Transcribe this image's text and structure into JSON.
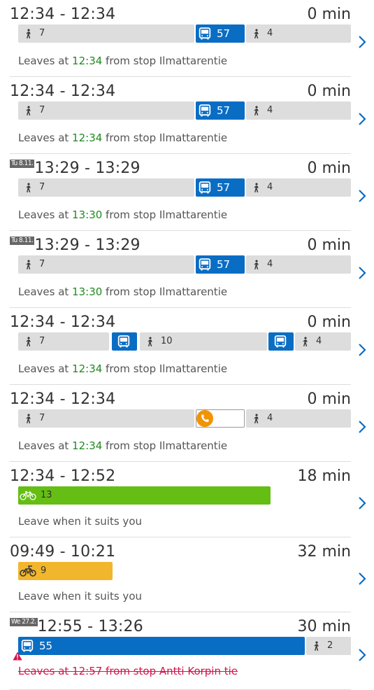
{
  "itineraries": [
    {
      "timeline": "12:34 - 12:34",
      "date_badge": "",
      "duration": "0 min",
      "legs": [
        {
          "mode": "walk",
          "label": "7"
        },
        {
          "mode": "bus",
          "label": "57"
        },
        {
          "mode": "walk",
          "label": "4"
        }
      ],
      "info_prefix": "Leaves at ",
      "info_time": "12:34",
      "info_suffix": " from stop Ilmattarentie",
      "cancelled": false
    },
    {
      "timeline": "12:34 - 12:34",
      "date_badge": "",
      "duration": "0 min",
      "legs": [
        {
          "mode": "walk",
          "label": "7"
        },
        {
          "mode": "bus",
          "label": "57"
        },
        {
          "mode": "walk",
          "label": "4"
        }
      ],
      "info_prefix": "Leaves at ",
      "info_time": "12:34",
      "info_suffix": " from stop Ilmattarentie",
      "cancelled": false
    },
    {
      "timeline": "13:29 - 13:29",
      "date_badge": "Tu 8.11.",
      "duration": "0 min",
      "legs": [
        {
          "mode": "walk",
          "label": "7"
        },
        {
          "mode": "bus",
          "label": "57"
        },
        {
          "mode": "walk",
          "label": "4"
        }
      ],
      "info_prefix": "Leaves at ",
      "info_time": "13:30",
      "info_suffix": " from stop Ilmattarentie",
      "cancelled": false
    },
    {
      "timeline": "13:29 - 13:29",
      "date_badge": "Tu 8.11.",
      "duration": "0 min",
      "legs": [
        {
          "mode": "walk",
          "label": "7"
        },
        {
          "mode": "bus",
          "label": "57"
        },
        {
          "mode": "walk",
          "label": "4"
        }
      ],
      "info_prefix": "Leaves at ",
      "info_time": "13:30",
      "info_suffix": " from stop Ilmattarentie",
      "cancelled": false
    },
    {
      "timeline": "12:34 - 12:34",
      "date_badge": "",
      "duration": "0 min",
      "legs": [
        {
          "mode": "walk",
          "label": "7"
        },
        {
          "mode": "bus-icon",
          "label": ""
        },
        {
          "mode": "walk",
          "label": "10"
        },
        {
          "mode": "bus-icon",
          "label": ""
        },
        {
          "mode": "walk",
          "label": "4"
        }
      ],
      "info_prefix": "Leaves at ",
      "info_time": "12:34",
      "info_suffix": " from stop Ilmattarentie",
      "cancelled": false
    },
    {
      "timeline": "12:34 - 12:34",
      "date_badge": "",
      "duration": "0 min",
      "legs": [
        {
          "mode": "walk",
          "label": "7"
        },
        {
          "mode": "call",
          "label": ""
        },
        {
          "mode": "walk",
          "label": "4"
        }
      ],
      "info_prefix": "Leaves at ",
      "info_time": "12:34",
      "info_suffix": " from stop Ilmattarentie",
      "cancelled": false
    },
    {
      "timeline": "12:34 - 12:52",
      "date_badge": "",
      "duration": "18 min",
      "legs": [
        {
          "mode": "bike",
          "label": "13"
        }
      ],
      "info_prefix": "Leave when it suits you",
      "info_time": "",
      "info_suffix": "",
      "cancelled": false
    },
    {
      "timeline": "09:49 - 10:21",
      "date_badge": "",
      "duration": "32 min",
      "legs": [
        {
          "mode": "citybike",
          "label": "9"
        }
      ],
      "info_prefix": "Leave when it suits you",
      "info_time": "",
      "info_suffix": "",
      "cancelled": false
    },
    {
      "timeline": "12:55 - 13:26",
      "date_badge": "We 27.2.",
      "duration": "30 min",
      "legs": [
        {
          "mode": "bus",
          "label": "55"
        },
        {
          "mode": "walk",
          "label": "2"
        }
      ],
      "info_prefix": "Leaves at ",
      "info_time": "12:57",
      "info_suffix": " from stop Antti Korpin tie",
      "cancelled": true
    }
  ],
  "icons": {
    "walk": "walk-icon",
    "bus": "bus-icon",
    "bike": "bicycle-icon",
    "citybike": "citybike-icon",
    "call": "phone-icon",
    "chevron": "chevron-right-icon",
    "alert": "alert-icon"
  },
  "colors": {
    "bus": "#0a6dc4",
    "walk_bg": "#dddddd",
    "bike": "#64be14",
    "citybike": "#f2b62d",
    "call_accent": "#f29400",
    "departure_time": "#1f8a1f",
    "cancelled": "#d4144a"
  }
}
